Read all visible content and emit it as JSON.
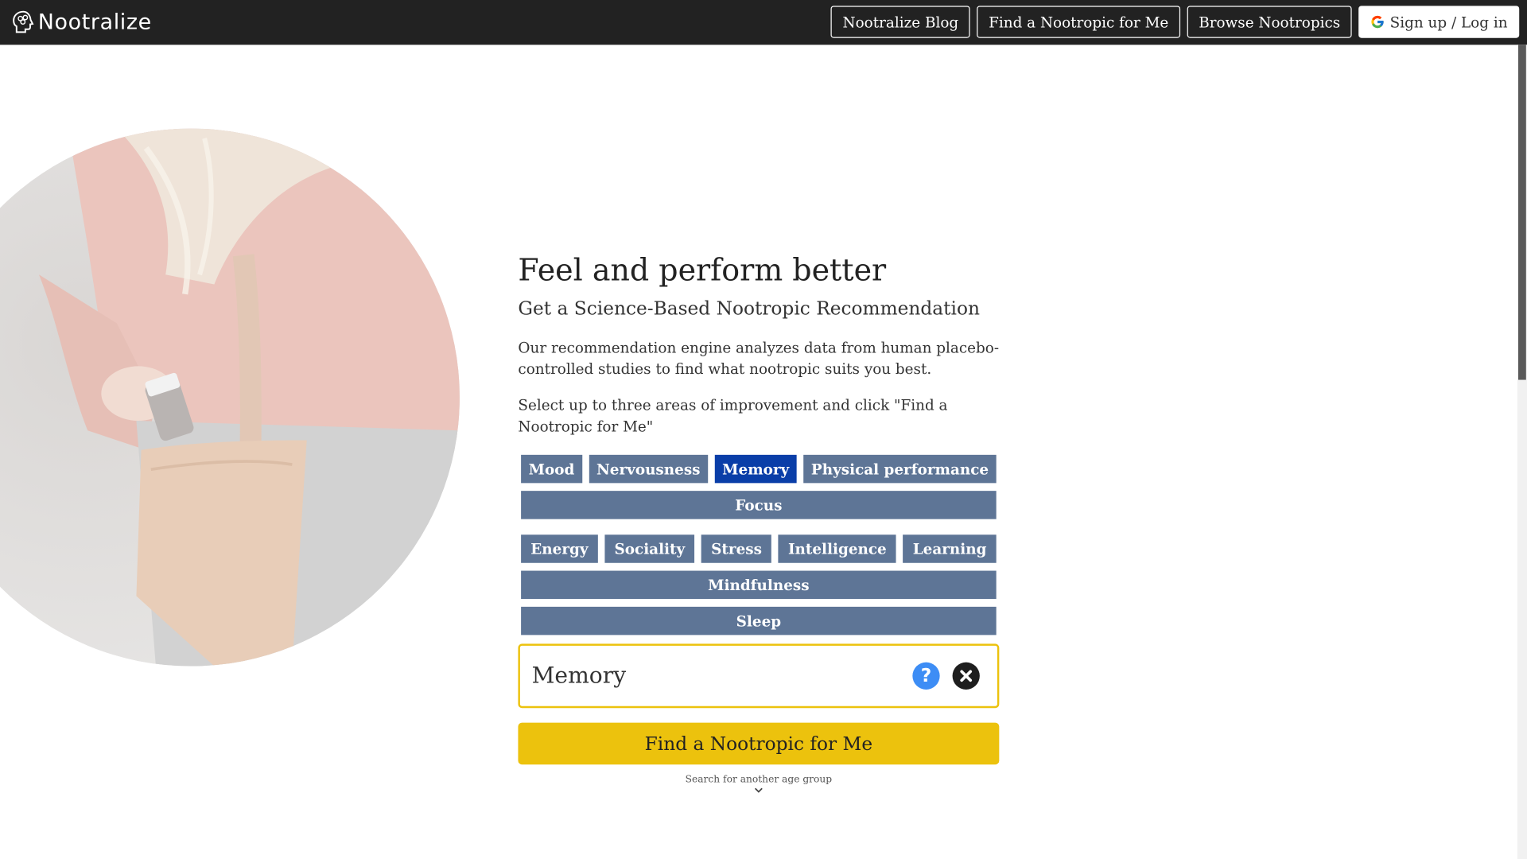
{
  "header": {
    "logo_text": "Nootralize",
    "nav": {
      "blog": "Nootralize Blog",
      "find": "Find a Nootropic for Me",
      "browse": "Browse Nootropics",
      "signup": "Sign up / Log in"
    }
  },
  "hero": {
    "headline": "Feel and perform better",
    "subhead": "Get a Science-Based Nootropic Recommendation",
    "paragraph1": "Our recommendation engine analyzes data from human placebo-controlled studies to find what nootropic suits you best.",
    "paragraph2": "Select up to three areas of improvement and click \"Find a Nootropic for Me\""
  },
  "areas": [
    {
      "label": "Mood",
      "selected": false
    },
    {
      "label": "Nervousness",
      "selected": false
    },
    {
      "label": "Memory",
      "selected": true
    },
    {
      "label": "Physical performance",
      "selected": false
    },
    {
      "label": "Focus",
      "selected": false
    },
    {
      "label": "Energy",
      "selected": false
    },
    {
      "label": "Sociality",
      "selected": false
    },
    {
      "label": "Stress",
      "selected": false
    },
    {
      "label": "Intelligence",
      "selected": false
    },
    {
      "label": "Learning",
      "selected": false
    },
    {
      "label": "Mindfulness",
      "selected": false
    },
    {
      "label": "Sleep",
      "selected": false
    }
  ],
  "selection": {
    "name": "Memory"
  },
  "cta_label": "Find a Nootropic for Me",
  "age_link": "Search for another age group",
  "colors": {
    "topbar": "#222222",
    "tag": "#5e7596",
    "tag_selected": "#0a3ea8",
    "accent_yellow": "#ecc20d",
    "help_blue": "#3d8df5"
  }
}
